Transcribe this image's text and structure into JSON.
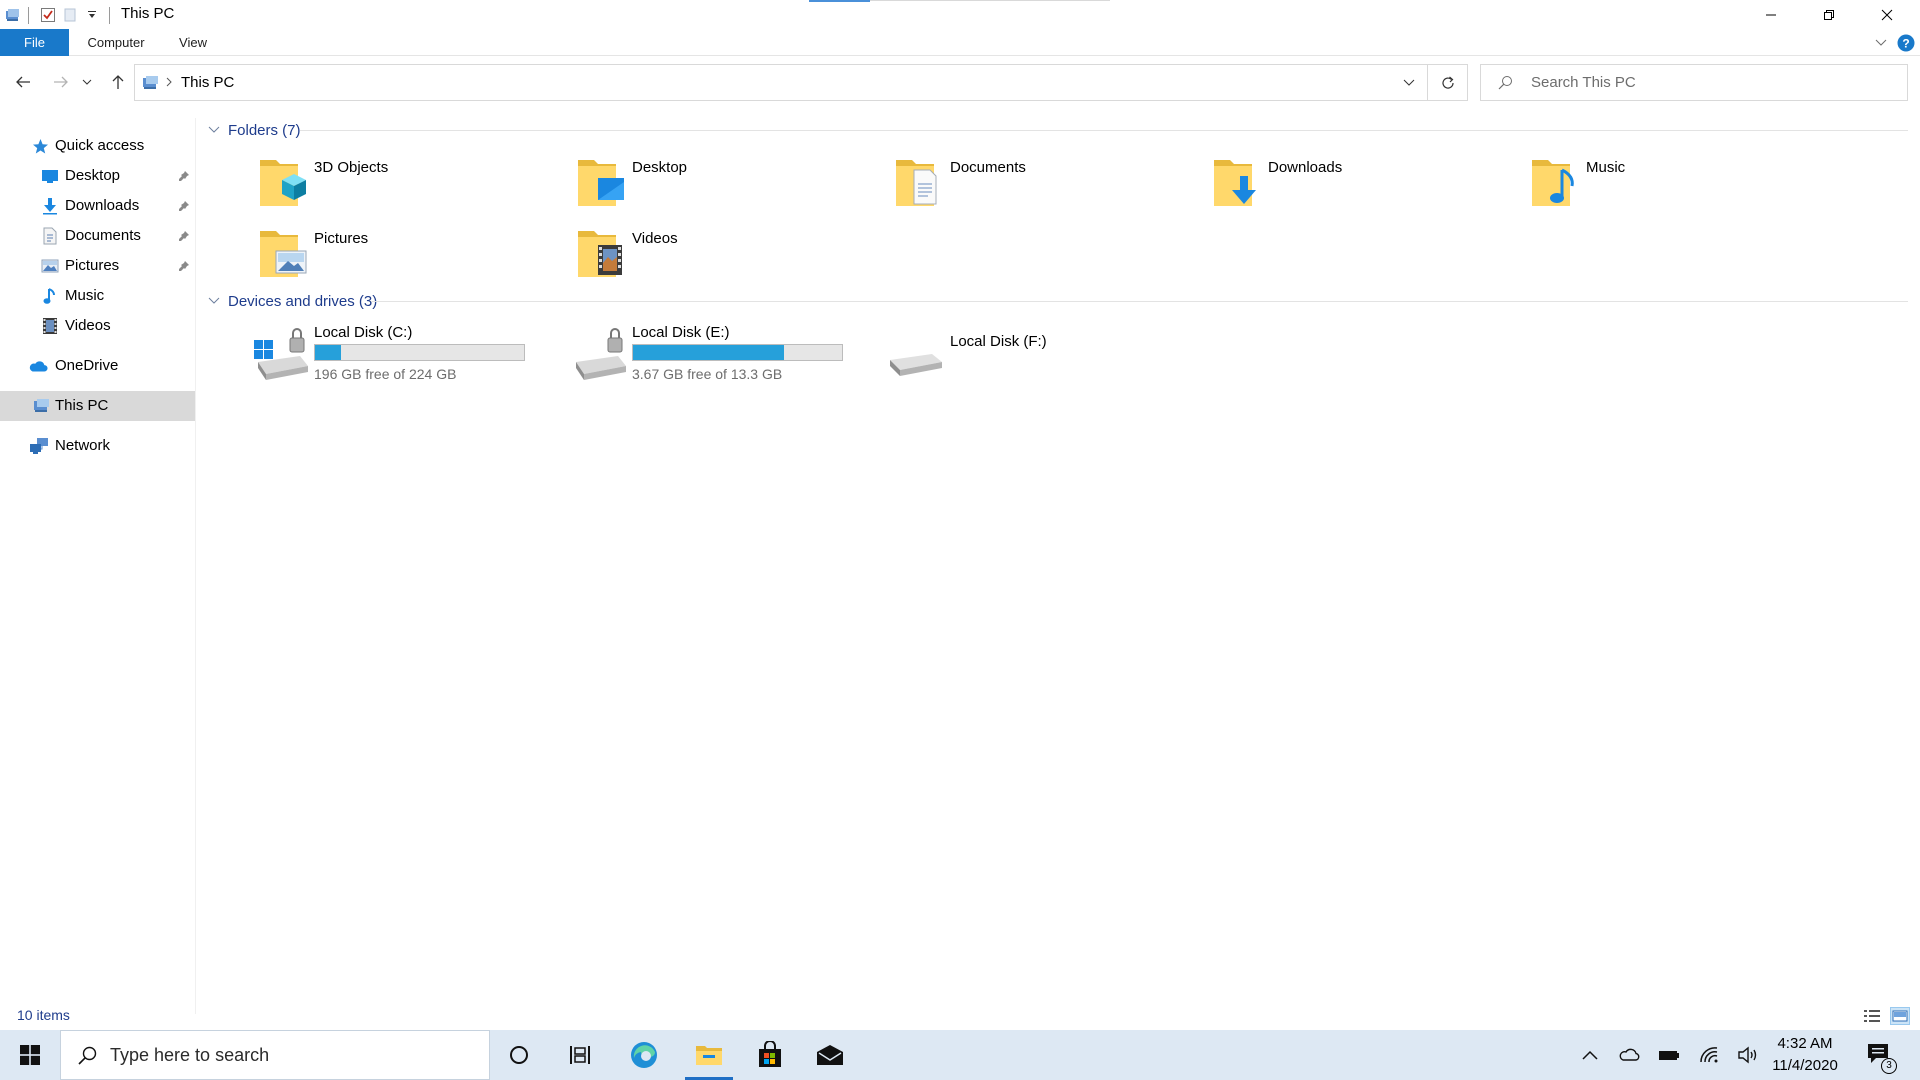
{
  "window": {
    "title": "This PC",
    "ribbon_tabs": [
      "File",
      "Computer",
      "View"
    ]
  },
  "address": {
    "crumb": "This PC",
    "search_placeholder": "Search This PC"
  },
  "sidebar": {
    "quick_access": "Quick access",
    "pinned": [
      {
        "label": "Desktop",
        "icon": "desktop-icon",
        "pinned": true
      },
      {
        "label": "Downloads",
        "icon": "downloads-icon",
        "pinned": true
      },
      {
        "label": "Documents",
        "icon": "documents-icon",
        "pinned": true
      },
      {
        "label": "Pictures",
        "icon": "pictures-icon",
        "pinned": true
      },
      {
        "label": "Music",
        "icon": "music-icon",
        "pinned": false
      },
      {
        "label": "Videos",
        "icon": "videos-icon",
        "pinned": false
      }
    ],
    "onedrive": "OneDrive",
    "this_pc": "This PC",
    "network": "Network"
  },
  "folders": {
    "header": "Folders (7)",
    "items": [
      "3D Objects",
      "Desktop",
      "Documents",
      "Downloads",
      "Music",
      "Pictures",
      "Videos"
    ]
  },
  "drives": {
    "header": "Devices and drives (3)",
    "items": [
      {
        "name": "Local Disk (C:)",
        "free": "196 GB free of 224 GB",
        "used_fraction": 0.125
      },
      {
        "name": "Local Disk (E:)",
        "free": "3.67 GB free of 13.3 GB",
        "used_fraction": 0.724
      },
      {
        "name": "Local Disk (F:)",
        "free": "",
        "used_fraction": null
      }
    ]
  },
  "status": {
    "count": "10 items"
  },
  "taskbar": {
    "search_placeholder": "Type here to search",
    "time": "4:32 AM",
    "date": "11/4/2020",
    "notification_count": "3"
  },
  "colors": {
    "accent": "#1979ca",
    "drive_bar": "#26a0da",
    "group_header": "#1e3c8c",
    "taskbar": "#dde8f3"
  }
}
